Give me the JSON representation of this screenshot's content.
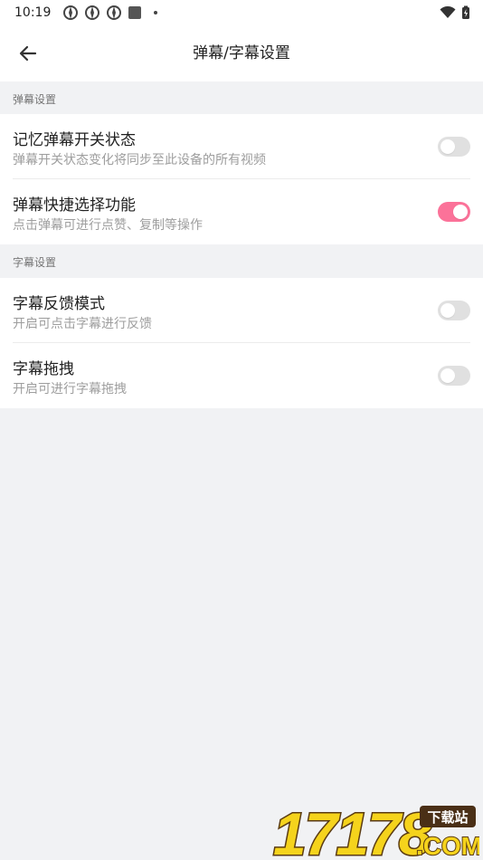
{
  "status_bar": {
    "time": "10:19"
  },
  "toolbar": {
    "title": "弹幕/字幕设置"
  },
  "sections": [
    {
      "header": "弹幕设置",
      "rows": [
        {
          "label": "记忆弹幕开关状态",
          "desc": "弹幕开关状态变化将同步至此设备的所有视频",
          "enabled": false
        },
        {
          "label": "弹幕快捷选择功能",
          "desc": "点击弹幕可进行点赞、复制等操作",
          "enabled": true
        }
      ]
    },
    {
      "header": "字幕设置",
      "rows": [
        {
          "label": "字幕反馈模式",
          "desc": "开启可点击字幕进行反馈",
          "enabled": false
        },
        {
          "label": "字幕拖拽",
          "desc": "开启可进行字幕拖拽",
          "enabled": false
        }
      ]
    }
  ],
  "colors": {
    "accent": "#fb7299",
    "background": "#f1f2f4"
  },
  "watermark": {
    "number": "17178",
    "badge": "下载站",
    "domain": ".COM"
  }
}
